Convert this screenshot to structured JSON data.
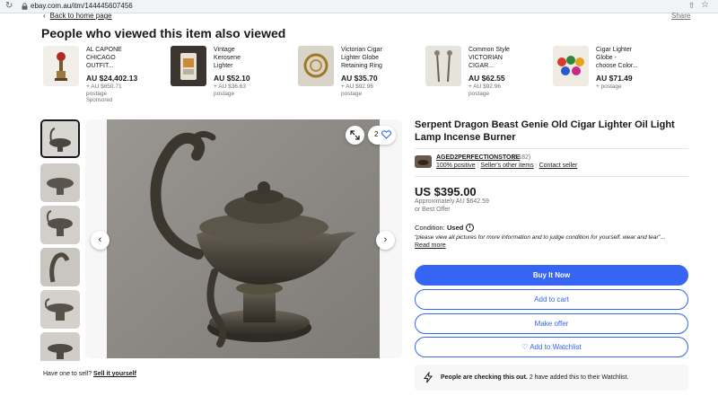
{
  "browser": {
    "url": "ebay.com.au/itm/144445607456"
  },
  "nav": {
    "back_label": "Back to home page",
    "share_label": "Share"
  },
  "recommendations": {
    "title": "People who viewed this item also viewed",
    "items": [
      {
        "name_line1": "AL CAPONE",
        "name_line2": "CHICAGO",
        "name_line3": "OUTFIT...",
        "price": "AU $24,402.13",
        "shipping_line1": "+ AU $650.71",
        "shipping_line2": "postage",
        "sponsored": "Sponsored"
      },
      {
        "name_line1": "Vintage",
        "name_line2": "Kerosene",
        "name_line3": "Lighter",
        "price": "AU $52.10",
        "shipping_line1": "+ AU $36.63",
        "shipping_line2": "postage"
      },
      {
        "name_line1": "Victorian Cigar",
        "name_line2": "Lighter Globe",
        "name_line3": "Retaining Ring",
        "price": "AU $35.70",
        "shipping_line1": "+ AU $92.96",
        "shipping_line2": "postage"
      },
      {
        "name_line1": "Common Style",
        "name_line2": "VICTORIAN",
        "name_line3": "CIGAR...",
        "price": "AU $62.55",
        "shipping_line1": "+ AU $92.96",
        "shipping_line2": "postage"
      },
      {
        "name_line1": "Cigar Lighter",
        "name_line2": "Globe -",
        "name_line3": "choose Color...",
        "price": "AU $71.49",
        "shipping_line1": "+ postage"
      }
    ]
  },
  "gallery": {
    "watch_count": "2"
  },
  "sell": {
    "prompt": "Have one to sell?",
    "link": "Sell it yourself"
  },
  "item": {
    "title": "Serpent Dragon Beast Genie Old Cigar Lighter Oil Light Lamp Incense Burner",
    "seller": {
      "name": "AGED2PERFECTIONSTORE",
      "feedback": "(5182)",
      "positive": "100% positive",
      "other_items": "Seller's other items",
      "contact": "Contact seller"
    },
    "price": "US $395.00",
    "approx": "Approximately AU $642.59",
    "best_offer": "or Best Offer",
    "condition_label": "Condition:",
    "condition_value": "Used",
    "condition_desc": "“please view all pictures for more information and to judge condition for yourself. wear and tear”...",
    "read_more": "Read more"
  },
  "buttons": {
    "buy_now": "Buy It Now",
    "add_to_cart": "Add to cart",
    "make_offer": "Make offer",
    "add_to_watchlist": "Add to Watchlist"
  },
  "activity": {
    "bold": "People are checking this out.",
    "rest": "2 have added this to their Watchlist."
  },
  "colors": {
    "primary": "#3665f3",
    "text": "#191919",
    "muted": "#707070"
  }
}
